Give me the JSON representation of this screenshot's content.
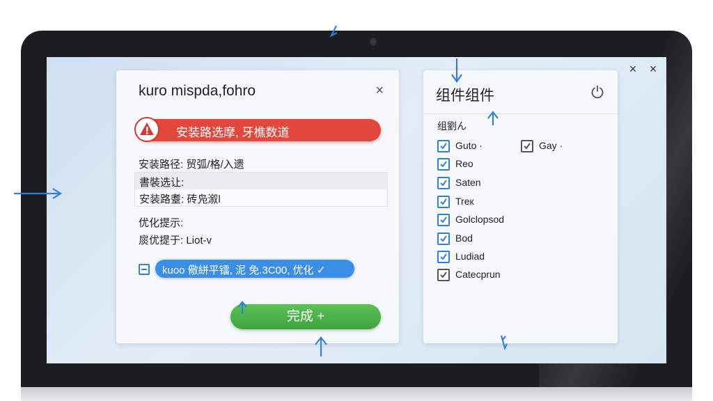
{
  "screen_controls": {
    "close_a": "×",
    "close_b": "×"
  },
  "dialog": {
    "title": "kuro mispda,fohro",
    "close": "×",
    "error_text": "安装路选摩, 牙樵数道",
    "path_line": "安装路径: 贸弧/格/入遗",
    "box_row1": "書裝选让:",
    "box_row2": "安装路耋: 砖凫溆l",
    "opt_label": "优化提示:",
    "opt_line": "扊优提于: Liot-v",
    "pill_text": "kuoo 儆絣平镭, 泥 免.3C00, 优化 ✓",
    "done_label": "完成 +"
  },
  "panel": {
    "title": "组件组件",
    "subheading": "组劉ん",
    "items": [
      {
        "label": "Guto ·",
        "checked": true
      },
      {
        "label": "Gay ·",
        "checked": true
      },
      {
        "label": "Reo",
        "checked": true
      },
      {
        "label": "Saten",
        "checked": true
      },
      {
        "label": "Treк",
        "checked": true
      },
      {
        "label": "Golclopsod",
        "checked": true
      },
      {
        "label": "Bod",
        "checked": true
      },
      {
        "label": "Ludiad",
        "checked": true
      },
      {
        "label": "Catecprun",
        "checked": true
      }
    ]
  },
  "colors": {
    "error_red": "#e2473c",
    "accent_blue": "#3b8ee6",
    "success_green": "#4cb249",
    "arrow_blue": "#2f7fdc"
  },
  "icons": [
    "warning-icon",
    "close-icon",
    "power-icon",
    "checkbox-icon",
    "arrow-icon"
  ]
}
